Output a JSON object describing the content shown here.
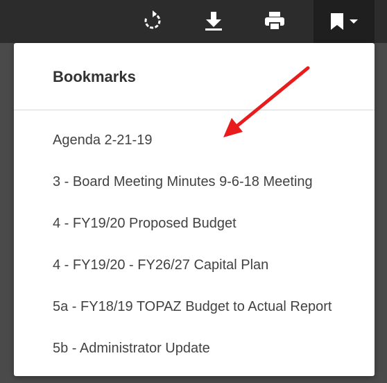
{
  "toolbar": {
    "icons": [
      "rotate-icon",
      "download-icon",
      "print-icon",
      "bookmark-icon",
      "caret-down-icon"
    ]
  },
  "bookmarks": {
    "title": "Bookmarks",
    "items": [
      "Agenda 2-21-19",
      "3 - Board Meeting Minutes 9-6-18 Meeting",
      "4 - FY19/20 Proposed Budget",
      "4 - FY19/20 - FY26/27 Capital Plan",
      "5a - FY18/19 TOPAZ Budget to Actual Report",
      "5b - Administrator Update"
    ]
  },
  "colors": {
    "toolbar_bg": "#2c2c2c",
    "panel_bg": "#ffffff",
    "arrow": "#e81c1c",
    "text": "#424242"
  }
}
